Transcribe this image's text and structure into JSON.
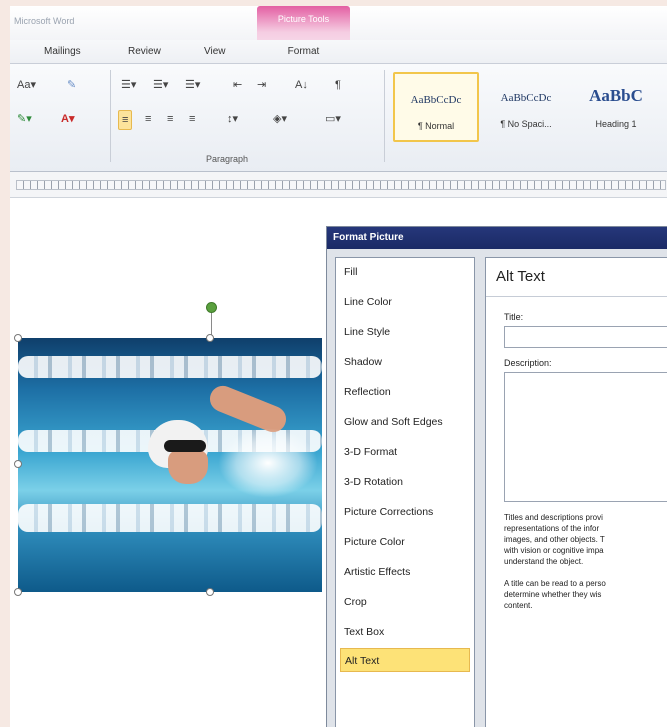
{
  "app": {
    "title": "Microsoft Word"
  },
  "context_tab_group": {
    "label": "Picture Tools"
  },
  "tabs": [
    "Mailings",
    "Review",
    "View",
    "Format"
  ],
  "ribbon": {
    "font_size_label": "Aa",
    "paragraph_label": "Paragraph",
    "pilcrow": "¶",
    "sort": "A↓",
    "styles": [
      {
        "sample": "AaBbCcDc",
        "name": "¶ Normal"
      },
      {
        "sample": "AaBbCcDc",
        "name": "¶ No Spaci..."
      },
      {
        "sample": "AaBbC",
        "name": "Heading 1"
      }
    ]
  },
  "dialog": {
    "title": "Format Picture",
    "categories": [
      "Fill",
      "Line Color",
      "Line Style",
      "Shadow",
      "Reflection",
      "Glow and Soft Edges",
      "3-D Format",
      "3-D Rotation",
      "Picture Corrections",
      "Picture Color",
      "Artistic Effects",
      "Crop",
      "Text Box",
      "Alt Text"
    ],
    "selected_category": "Alt Text",
    "pane": {
      "heading": "Alt Text",
      "title_label": "Title:",
      "title_value": "",
      "description_label": "Description:",
      "description_value": "",
      "help1": "Titles and descriptions provi\nrepresentations of the infor\nimages, and other objects. T\nwith vision or cognitive impa\nunderstand the object.",
      "help2": "A title can be read to a perso\ndetermine whether they wis\ncontent."
    }
  },
  "colors": {
    "accent_pink": "#e35fa3",
    "highlight": "#fde277",
    "dialog_title": "#1f2f70"
  }
}
